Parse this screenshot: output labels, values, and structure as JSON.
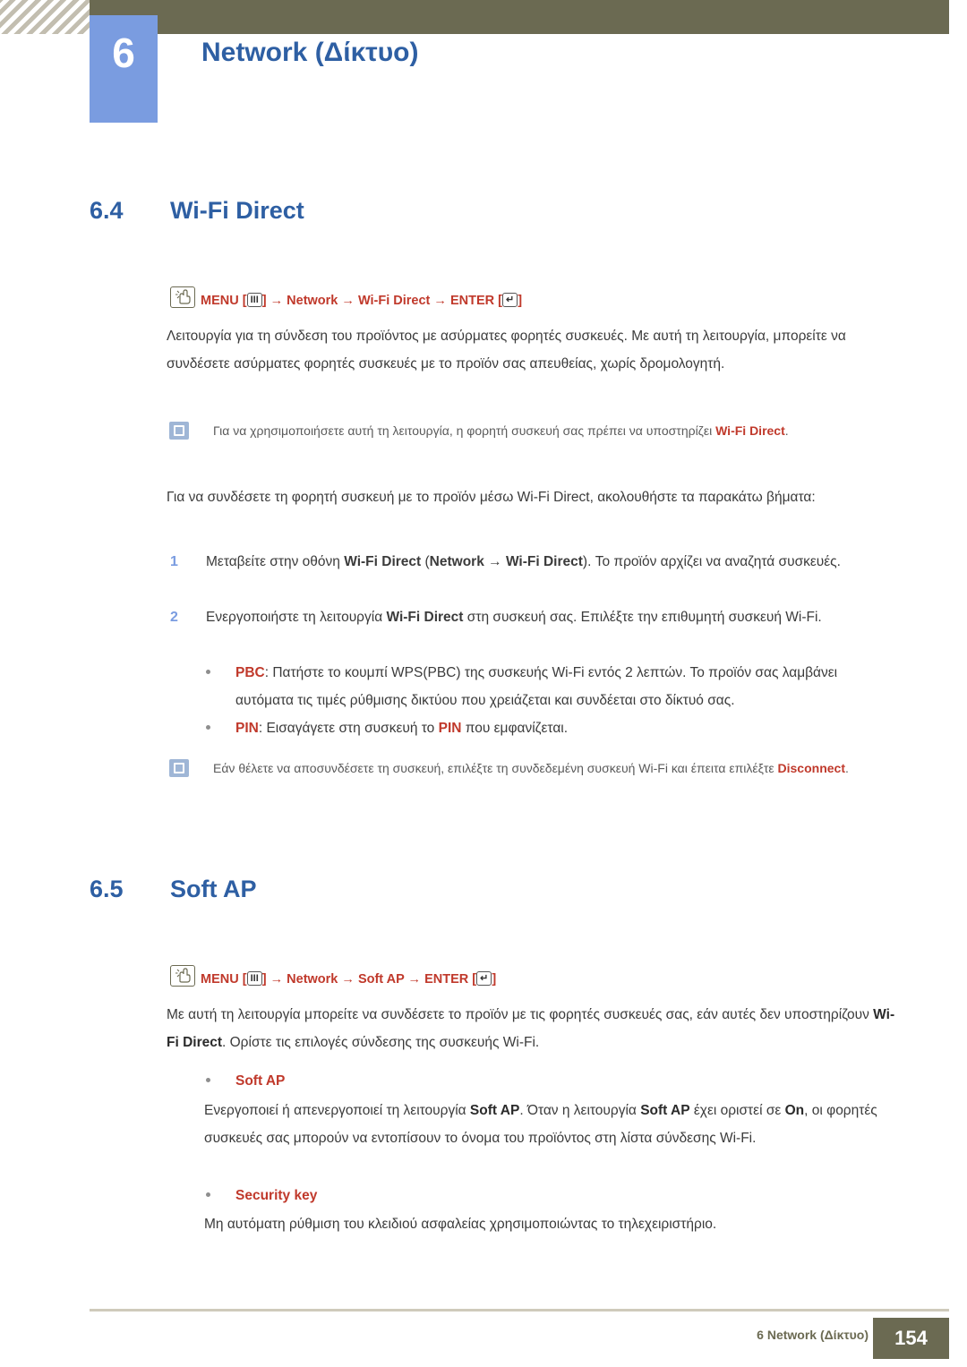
{
  "header": {
    "chapter_number": "6",
    "chapter_title": "Network (Δίκτυο)"
  },
  "sections": [
    {
      "number": "6.4",
      "title": "Wi-Fi Direct",
      "menu_path": {
        "menu_label": "MENU",
        "key1": "III",
        "arrow": "→",
        "item1": "Network",
        "item2": "Wi-Fi Direct",
        "enter_label": "ENTER",
        "key2": "↵"
      }
    },
    {
      "number": "6.5",
      "title": "Soft AP",
      "menu_path": {
        "menu_label": "MENU",
        "key1": "III",
        "arrow": "→",
        "item1": "Network",
        "item2": "Soft AP",
        "enter_label": "ENTER",
        "key2": "↵"
      }
    }
  ],
  "body": {
    "p1": "Λειτουργία για τη σύνδεση του προϊόντος με ασύρματες φορητές συσκευές. Με αυτή τη λειτουργία, μπορείτε να συνδέσετε ασύρματες φορητές συσκευές με το προϊόν σας απευθείας, χωρίς δρομολογητή.",
    "note1_pre": "Για να χρησιμοποιήσετε αυτή τη λειτουργία, η φορητή συσκευή σας πρέπει να υποστηρίζει ",
    "note1_hl": "Wi-Fi Direct",
    "note1_post": ".",
    "p2": "Για να συνδέσετε τη φορητή συσκευή με το προϊόν μέσω Wi-Fi Direct, ακολουθήστε τα παρακάτω βήματα:",
    "step1_num": "1",
    "step1_a": "Μεταβείτε στην οθόνη ",
    "step1_b": "Wi-Fi Direct",
    "step1_c": " (",
    "step1_d": "Network",
    "step1_e": " → ",
    "step1_f": "Wi-Fi Direct",
    "step1_g": "). Το προϊόν αρχίζει να αναζητά συσκευές.",
    "step2_num": "2",
    "step2_a": "Ενεργοποιήστε τη λειτουργία ",
    "step2_b": "Wi-Fi Direct",
    "step2_c": " στη συσκευή σας. Επιλέξτε την επιθυμητή συσκευή Wi-Fi.",
    "bullet_pbc_label": "PBC",
    "bullet_pbc_text": ": Πατήστε το κουμπί WPS(PBC) της συσκευής Wi-Fi εντός 2 λεπτών. Το προϊόν σας λαμβάνει αυτόματα τις τιμές ρύθμισης δικτύου που χρειάζεται και συνδέεται στο δίκτυό σας.",
    "bullet_pin_label": "PIN",
    "bullet_pin_a": ": Εισαγάγετε στη συσκευή το ",
    "bullet_pin_b": "PIN",
    "bullet_pin_c": " που εμφανίζεται.",
    "note2_pre": "Εάν θέλετε να αποσυνδέσετε τη συσκευή, επιλέξτε τη συνδεδεμένη συσκευή Wi-Fi και έπειτα επιλέξτε ",
    "note2_hl": "Disconnect",
    "note2_post": ".",
    "p3_a": "Με αυτή τη λειτουργία μπορείτε να συνδέσετε το προϊόν με τις φορητές συσκευές σας, εάν αυτές δεν υποστηρίζουν ",
    "p3_b": "Wi-Fi Direct",
    "p3_c": ". Ορίστε τις επιλογές σύνδεσης της συσκευής Wi-Fi.",
    "soft_ap_label": "Soft AP",
    "soft_ap_a": "Ενεργοποιεί ή απενεργοποιεί τη λειτουργία ",
    "soft_ap_b": "Soft AP",
    "soft_ap_c": ". Όταν η λειτουργία ",
    "soft_ap_d": "Soft AP",
    "soft_ap_e": " έχει οριστεί σε ",
    "soft_ap_f": "On",
    "soft_ap_g": ", οι φορητές συσκευές σας μπορούν να εντοπίσουν το όνομα του προϊόντος στη λίστα σύνδεσης Wi-Fi.",
    "security_key_label": "Security key",
    "security_key_text": "Μη αυτόματη ρύθμιση του κλειδιού ασφαλείας χρησιμοποιώντας το τηλεχειριστήριο."
  },
  "footer": {
    "text": "6 Network (Δίκτυο)",
    "page": "154"
  },
  "colors": {
    "accent_blue": "#2e5fa3",
    "light_blue": "#7a9ce0",
    "olive": "#6b6a52",
    "red": "#c0392b"
  }
}
